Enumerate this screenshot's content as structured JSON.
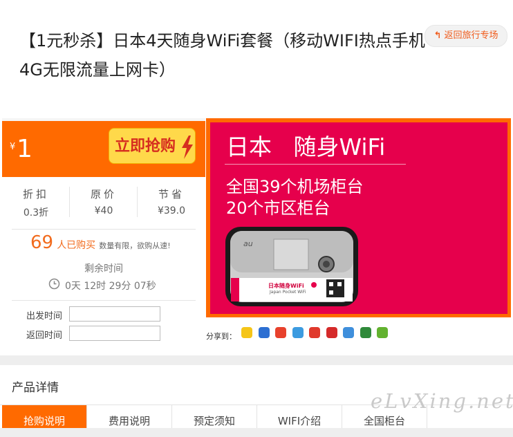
{
  "header": {
    "title": "【1元秒杀】日本4天随身WiFi套餐（移动WIFI热点手机4G无限流量上网卡）",
    "back_label": "返回旅行专场"
  },
  "deal": {
    "currency": "¥",
    "price": "1",
    "buy_label": "立即抢购",
    "stats": [
      {
        "label": "折扣",
        "value": "0.3折"
      },
      {
        "label": "原价",
        "value": "¥40"
      },
      {
        "label": "节省",
        "value": "¥39.0"
      }
    ],
    "buyers_count": "69",
    "buyers_text": "人已购买",
    "buyers_note": "数量有限，欲购从速!",
    "remaining_label": "剩余时间",
    "countdown": "0天 12时 29分 07秒",
    "depart_label": "出发时间",
    "return_label": "返回时间"
  },
  "banner": {
    "headline": "日本   随身WiFi",
    "line1": "全国39个机场柜台",
    "line2": "20个市区柜台",
    "device_brand": "au",
    "device_card": "日本随身WiFi",
    "device_card_sub": "Japan Pocket WiFi"
  },
  "share": {
    "label": "分享到：",
    "icons": [
      "qzone-icon",
      "baidu-icon",
      "weibo-icon",
      "pengyou-icon",
      "tencent-weibo-icon",
      "renren-icon",
      "kaixin-icon",
      "douban-icon",
      "wechat-icon"
    ]
  },
  "details": {
    "title": "产品详情",
    "tabs": [
      "抢购说明",
      "费用说明",
      "预定须知",
      "WIFI介绍",
      "全国柜台"
    ]
  },
  "watermark": "eLvXing.net",
  "colors": {
    "accent": "#ff6a00",
    "banner_red": "#e6004c",
    "price_text": "#f26b1d"
  }
}
